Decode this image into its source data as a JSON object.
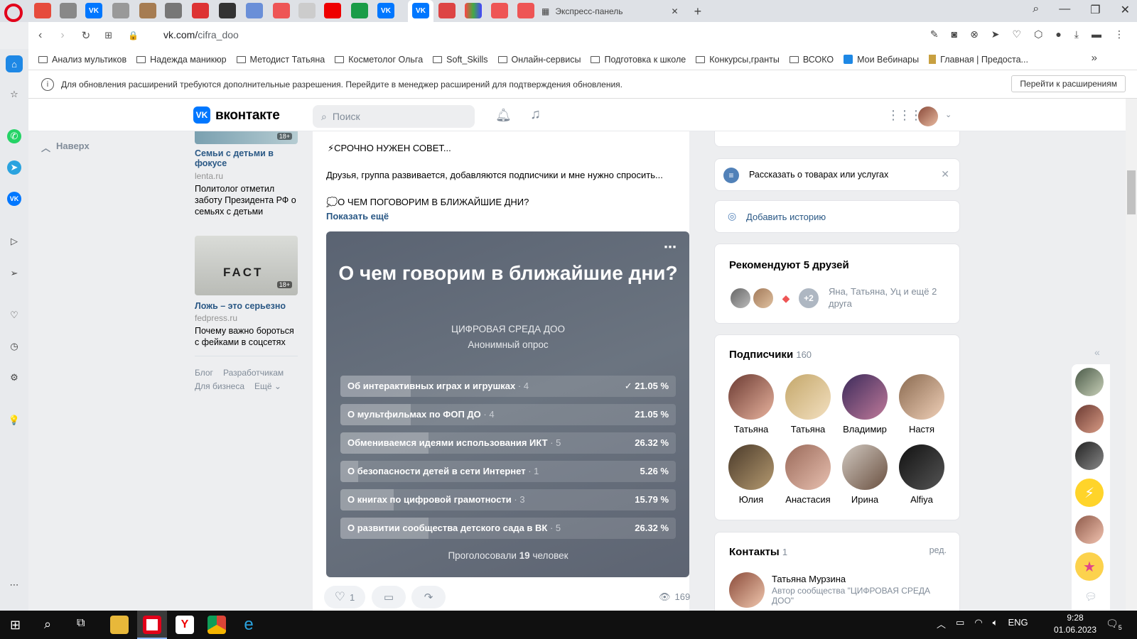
{
  "browser": {
    "tab_express_label": "Экспресс-панель",
    "url_host": "vk.com/",
    "url_path": "cifra_doo",
    "bookmarks": [
      "Анализ мультиков",
      "Надежда маникюр",
      "Методист Татьяна",
      "Косметолог Ольга",
      "Soft_Skills",
      "Онлайн-сервисы",
      "Подготовка к школе",
      "Конкурсы,гранты",
      "ВСОКО",
      "Мои Вебинары",
      "Главная | Предоста..."
    ],
    "ext_notice": "Для обновления расширений требуются дополнительные разрешения. Перейдите в менеджер расширений для подтверждения обновления.",
    "ext_button": "Перейти к расширениям",
    "more_bookmarks": "»"
  },
  "vk": {
    "logo_text": "вконтакте",
    "search_placeholder": "Поиск",
    "nav_up": "Наверх"
  },
  "ads": [
    {
      "title": "Семьи с детьми в фокусе",
      "source": "lenta.ru",
      "text": "Политолог отметил заботу Президента РФ о семьях с детьми",
      "badge": "18+"
    },
    {
      "title": "Ложь – это серьезно",
      "source": "fedpress.ru",
      "text": "Почему важно бороться с фейками в соцсетях",
      "badge": "18+",
      "img_text": "FACT"
    }
  ],
  "footer_links": {
    "blog": "Блог",
    "dev": "Разработчикам",
    "biz": "Для бизнеса",
    "more": "Ещё"
  },
  "post": {
    "line1": "⚡СРОЧНО НУЖЕН СОВЕТ...",
    "line2": "Друзья, группа развивается, добавляются подписчики и мне нужно спросить...",
    "line3": "💭О ЧЕМ ПОГОВОРИМ В БЛИЖАЙШИЕ ДНИ?",
    "show_more": "Показать ещё",
    "likes": "1",
    "views": "169"
  },
  "poll": {
    "title": "О чем говорим в ближайшие дни?",
    "author": "ЦИФРОВАЯ СРЕДА ДОО",
    "type": "Анонимный опрос",
    "voted_prefix": "Проголосовали",
    "voted_count": "19",
    "voted_suffix": "человек",
    "options": [
      {
        "label": "Об интерактивных играх и игрушках",
        "count": "· 4",
        "percent": "21.05 %",
        "value": 21.05,
        "checked": true
      },
      {
        "label": "О мультфильмах по ФОП ДО",
        "count": "· 4",
        "percent": "21.05 %",
        "value": 21.05
      },
      {
        "label": "Обмениваемся идеями использования ИКТ",
        "count": "· 5",
        "percent": "26.32 %",
        "value": 26.32
      },
      {
        "label": "О безопасности детей в сети Интернет",
        "count": "· 1",
        "percent": "5.26 %",
        "value": 5.26
      },
      {
        "label": "О книгах по цифровой грамотности",
        "count": "· 3",
        "percent": "15.79 %",
        "value": 15.79
      },
      {
        "label": "О развитии сообщества детского сада в ВК",
        "count": "· 5",
        "percent": "26.32 %",
        "value": 26.32
      }
    ]
  },
  "right": {
    "tell_goods": "Рассказать о товарах или услугах",
    "add_story": "Добавить историю",
    "recommend_title": "Рекомендуют 5 друзей",
    "recommend_more": "+2",
    "recommend_text": "Яна, Татьяна, Уц и ещё 2 друга",
    "subs_title": "Подписчики",
    "subs_count": "160",
    "subscribers": [
      "Татьяна",
      "Татьяна",
      "Владимир",
      "Настя",
      "Юлия",
      "Анастасия",
      "Ирина",
      "Alfiya"
    ],
    "contacts_title": "Контакты",
    "contacts_count": "1",
    "contacts_edit": "ред.",
    "contact_name": "Татьяна Мурзина",
    "contact_role": "Автор сообщества \"ЦИФРОВАЯ СРЕДА ДОО\""
  },
  "taskbar": {
    "lang": "ENG",
    "time": "9:28",
    "date": "01.06.2023",
    "notif_count": "5"
  },
  "colors": {
    "vk_blue": "#0077ff",
    "link": "#2a5885",
    "opera_red": "#e2001a"
  }
}
